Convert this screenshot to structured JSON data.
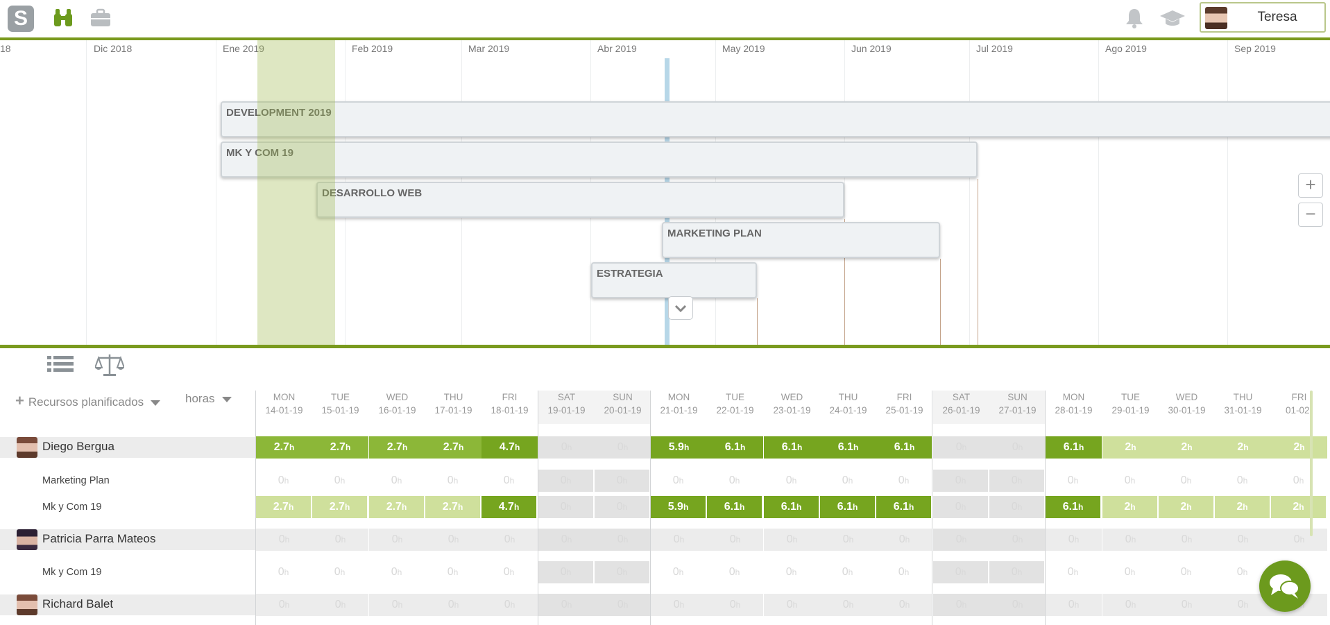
{
  "topbar": {
    "logo_letter": "S",
    "user_name": "Teresa",
    "icons": [
      "binoculars-icon",
      "briefcase-icon",
      "bell-icon",
      "graduation-cap-icon"
    ]
  },
  "timeline": {
    "months": [
      "18",
      "Dic 2018",
      "Ene 2019",
      "Feb 2019",
      "Mar 2019",
      "Abr 2019",
      "May 2019",
      "Jun 2019",
      "Jul 2019",
      "Ago 2019",
      "Sep 2019"
    ],
    "projects": [
      "DEVELOPMENT 2019",
      "MK Y COM 19",
      "DESARROLLO WEB",
      "MARKETING PLAN",
      "ESTRATEGIA"
    ],
    "zoom_in": "+",
    "zoom_out": "−"
  },
  "grid": {
    "resources_label": "Recursos planificados",
    "unit_label": "horas",
    "days": [
      {
        "dow": "MON",
        "date": "14-01-19"
      },
      {
        "dow": "TUE",
        "date": "15-01-19"
      },
      {
        "dow": "WED",
        "date": "16-01-19"
      },
      {
        "dow": "THU",
        "date": "17-01-19"
      },
      {
        "dow": "FRI",
        "date": "18-01-19"
      },
      {
        "dow": "SAT",
        "date": "19-01-19"
      },
      {
        "dow": "SUN",
        "date": "20-01-19"
      },
      {
        "dow": "MON",
        "date": "21-01-19"
      },
      {
        "dow": "TUE",
        "date": "22-01-19"
      },
      {
        "dow": "WED",
        "date": "23-01-19"
      },
      {
        "dow": "THU",
        "date": "24-01-19"
      },
      {
        "dow": "FRI",
        "date": "25-01-19"
      },
      {
        "dow": "SAT",
        "date": "26-01-19"
      },
      {
        "dow": "SUN",
        "date": "27-01-19"
      },
      {
        "dow": "MON",
        "date": "28-01-19"
      },
      {
        "dow": "TUE",
        "date": "29-01-19"
      },
      {
        "dow": "WED",
        "date": "30-01-19"
      },
      {
        "dow": "THU",
        "date": "31-01-19"
      },
      {
        "dow": "FRI",
        "date": "01-02-"
      }
    ],
    "rows": [
      {
        "label": "Diego Bergua",
        "kind": "person",
        "values": [
          "2.7",
          "2.7",
          "2.7",
          "2.7",
          "4.7",
          "0",
          "0",
          "5.9",
          "6.1",
          "6.1",
          "6.1",
          "6.1",
          "0",
          "0",
          "6.1",
          "2",
          "2",
          "2",
          "2"
        ]
      },
      {
        "label": "Marketing Plan",
        "kind": "project",
        "values": [
          "0",
          "0",
          "0",
          "0",
          "0",
          "0",
          "0",
          "0",
          "0",
          "0",
          "0",
          "0",
          "0",
          "0",
          "0",
          "0",
          "0",
          "0",
          "0"
        ]
      },
      {
        "label": "Mk y Com 19",
        "kind": "project",
        "values": [
          "2.7",
          "2.7",
          "2.7",
          "2.7",
          "4.7",
          "0",
          "0",
          "5.9",
          "6.1",
          "6.1",
          "6.1",
          "6.1",
          "0",
          "0",
          "6.1",
          "2",
          "2",
          "2",
          "2"
        ]
      },
      {
        "label": "Patricia Parra Mateos",
        "kind": "person",
        "values": [
          "0",
          "0",
          "0",
          "0",
          "0",
          "0",
          "0",
          "0",
          "0",
          "0",
          "0",
          "0",
          "0",
          "0",
          "0",
          "0",
          "0",
          "0",
          "0"
        ]
      },
      {
        "label": "Mk y Com 19",
        "kind": "project",
        "values": [
          "0",
          "0",
          "0",
          "0",
          "0",
          "0",
          "0",
          "0",
          "0",
          "0",
          "0",
          "0",
          "0",
          "0",
          "0",
          "0",
          "0",
          "0",
          "0"
        ]
      },
      {
        "label": "Richard Balet",
        "kind": "person",
        "values": [
          "0",
          "0",
          "0",
          "0",
          "0",
          "0",
          "0",
          "0",
          "0",
          "0",
          "0",
          "0",
          "0",
          "0",
          "0",
          "0",
          "0",
          "0",
          "0"
        ]
      }
    ],
    "unit_suffix": "h"
  }
}
